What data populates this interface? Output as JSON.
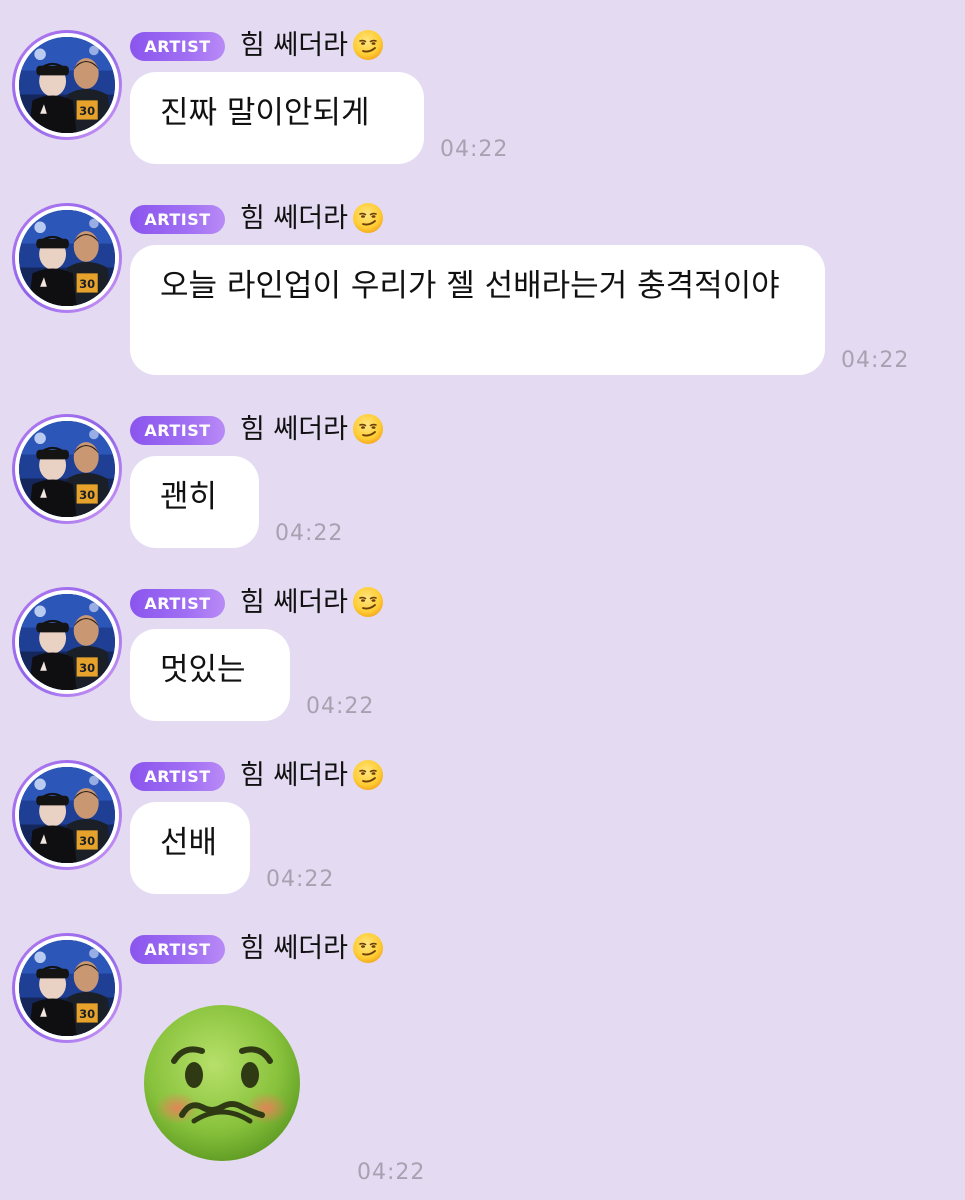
{
  "messages": [
    {
      "badge": "ARTIST",
      "nickname": "힘 쎄더라",
      "nickname_emoji": "smirking-face-emoji",
      "text": "진짜 말이안되게",
      "time": "04:22"
    },
    {
      "badge": "ARTIST",
      "nickname": "힘 쎄더라",
      "nickname_emoji": "smirking-face-emoji",
      "text": "오늘 라인업이 우리가 젤 선배라는거 충격적이야",
      "time": "04:22"
    },
    {
      "badge": "ARTIST",
      "nickname": "힘 쎄더라",
      "nickname_emoji": "smirking-face-emoji",
      "text": "괜히",
      "time": "04:22"
    },
    {
      "badge": "ARTIST",
      "nickname": "힘 쎄더라",
      "nickname_emoji": "smirking-face-emoji",
      "text": "멋있는",
      "time": "04:22"
    },
    {
      "badge": "ARTIST",
      "nickname": "힘 쎄더라",
      "nickname_emoji": "smirking-face-emoji",
      "text": "선배",
      "time": "04:22"
    },
    {
      "badge": "ARTIST",
      "nickname": "힘 쎄더라",
      "nickname_emoji": "smirking-face-emoji",
      "sticker": "nauseated-face-emoji",
      "time": "04:22"
    }
  ],
  "colors": {
    "background": "#e4dbf3",
    "badge": "#8a55ee",
    "bubble": "#ffffff",
    "timestamp": "#a7a1b0"
  }
}
